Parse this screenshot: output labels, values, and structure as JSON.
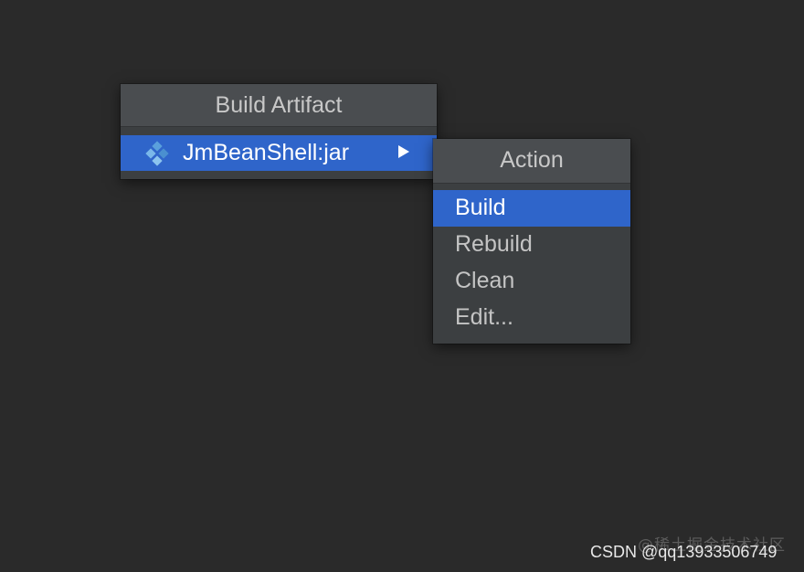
{
  "build_artifact_popup": {
    "title": "Build Artifact",
    "items": [
      {
        "label": "JmBeanShell:jar",
        "icon": "artifact-icon",
        "selected": true,
        "has_submenu": true
      }
    ]
  },
  "action_popup": {
    "title": "Action",
    "items": [
      {
        "label": "Build",
        "selected": true
      },
      {
        "label": "Rebuild",
        "selected": false
      },
      {
        "label": "Clean",
        "selected": false
      },
      {
        "label": "Edit...",
        "selected": false
      }
    ]
  },
  "watermark": {
    "site": "@稀土掘金技术社区",
    "credit": "CSDN @qq13933506749"
  },
  "colors": {
    "background": "#2a2a2a",
    "popup_body": "#3c3f41",
    "popup_header": "#4a4d50",
    "selection": "#2f65ca",
    "text": "#c4c4c4",
    "text_selected": "#ffffff",
    "artifact_icon": "#5aa0dc"
  }
}
